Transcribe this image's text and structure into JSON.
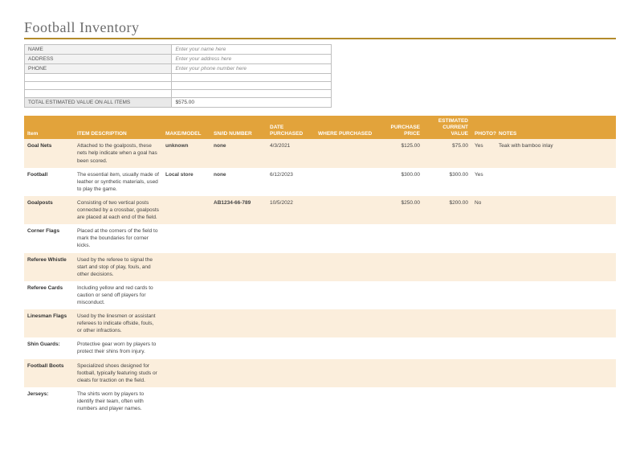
{
  "title": "Football Inventory",
  "info": {
    "rows": [
      {
        "label": "NAME",
        "value": "Enter your name here"
      },
      {
        "label": "ADDRESS",
        "value": "Enter your address here"
      },
      {
        "label": "PHONE",
        "value": "Enter your phone number here"
      },
      {
        "label": "",
        "value": ""
      },
      {
        "label": "",
        "value": ""
      },
      {
        "label": "",
        "value": ""
      }
    ],
    "total_label": "TOTAL ESTIMATED VALUE ON ALL ITEMS",
    "total_value": "$575.00"
  },
  "columns": {
    "item": "Item",
    "desc": "ITEM DESCRIPTION",
    "make": "MAKE/MODEL",
    "sn": "SN/ID NUMBER",
    "date": "DATE PURCHASED",
    "where": "WHERE PURCHASED",
    "price": "PURCHASE PRICE",
    "value": "ESTIMATED CURRENT VALUE",
    "photo": "PHOTO?",
    "notes": "NOTES"
  },
  "rows": [
    {
      "item": "Goal Nets",
      "desc": "Attached to the goalposts, these nets help indicate when a goal has been scored.",
      "make": "unknown",
      "sn": "none",
      "date": "4/3/2021",
      "where": "",
      "price": "$125.00",
      "value": "$75.00",
      "photo": "Yes",
      "notes": "Teak with bamboo inlay"
    },
    {
      "item": "Football",
      "desc": "The essential item, usually made of leather or synthetic materials, used to play the game.",
      "make": "Local store",
      "sn": "none",
      "date": "6/12/2023",
      "where": "",
      "price": "$300.00",
      "value": "$300.00",
      "photo": "Yes",
      "notes": ""
    },
    {
      "item": "Goalposts",
      "desc": "Consisting of two vertical posts connected by a crossbar, goalposts are placed at each end of the field.",
      "make": "",
      "sn": "AB1234-66-789",
      "date": "10/5/2022",
      "where": "",
      "price": "$250.00",
      "value": "$200.00",
      "photo": "No",
      "notes": ""
    },
    {
      "item": "Corner Flags",
      "desc": "Placed at the corners of the field to mark the boundaries for corner kicks.",
      "make": "",
      "sn": "",
      "date": "",
      "where": "",
      "price": "",
      "value": "",
      "photo": "",
      "notes": ""
    },
    {
      "item": "Referee Whistle",
      "desc": "Used by the referee to signal the start and stop of play, fouls, and other decisions.",
      "make": "",
      "sn": "",
      "date": "",
      "where": "",
      "price": "",
      "value": "",
      "photo": "",
      "notes": ""
    },
    {
      "item": "Referee Cards",
      "desc": "Including yellow and red cards to caution or send off players for misconduct.",
      "make": "",
      "sn": "",
      "date": "",
      "where": "",
      "price": "",
      "value": "",
      "photo": "",
      "notes": ""
    },
    {
      "item": "Linesman Flags",
      "desc": "Used by the linesmen or assistant referees to indicate offside, fouls, or other infractions.",
      "make": "",
      "sn": "",
      "date": "",
      "where": "",
      "price": "",
      "value": "",
      "photo": "",
      "notes": ""
    },
    {
      "item": "Shin Guards:",
      "desc": "Protective gear worn by players to protect their shins from injury.",
      "make": "",
      "sn": "",
      "date": "",
      "where": "",
      "price": "",
      "value": "",
      "photo": "",
      "notes": ""
    },
    {
      "item": "Football Boots",
      "desc": "Specialized shoes designed for football, typically featuring studs or cleats for traction on the field.",
      "make": "",
      "sn": "",
      "date": "",
      "where": "",
      "price": "",
      "value": "",
      "photo": "",
      "notes": ""
    },
    {
      "item": "Jerseys:",
      "desc": "The shirts worn by players to identify their team, often with numbers and player names.",
      "make": "",
      "sn": "",
      "date": "",
      "where": "",
      "price": "",
      "value": "",
      "photo": "",
      "notes": ""
    }
  ]
}
